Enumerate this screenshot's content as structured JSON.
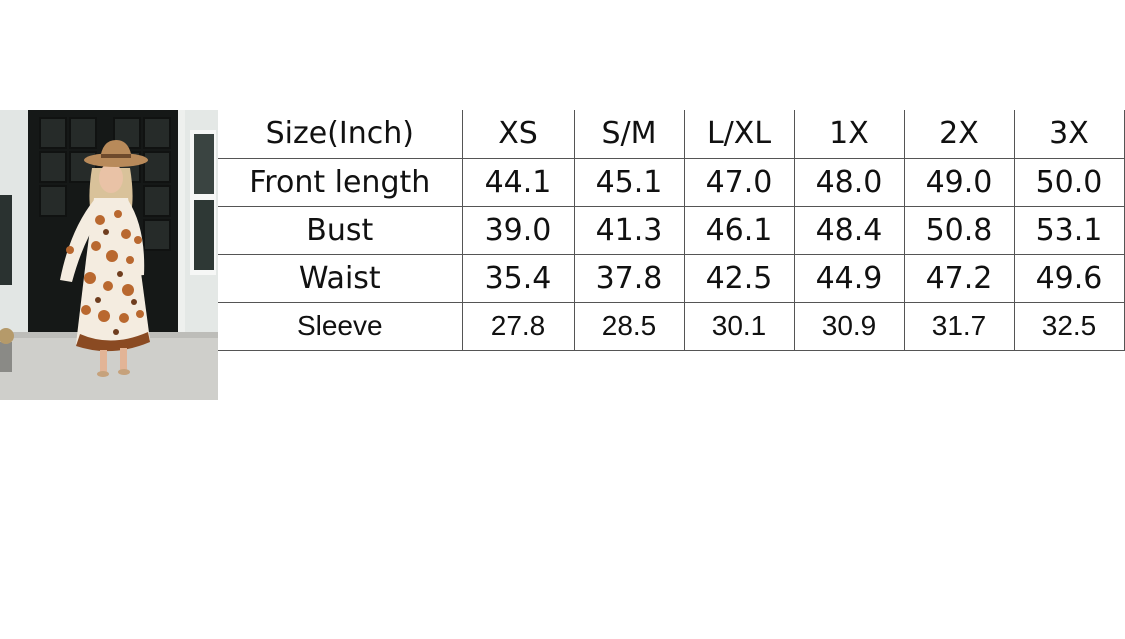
{
  "product_photo": {
    "icon": "woman-in-floral-maxi-dress-photo"
  },
  "size_chart": {
    "header": [
      "Size(Inch)",
      "XS",
      "S/M",
      "L/XL",
      "1X",
      "2X",
      "3X"
    ],
    "rows": [
      [
        "Front length",
        "44.1",
        "45.1",
        "47.0",
        "48.0",
        "49.0",
        "50.0"
      ],
      [
        "Bust",
        "39.0",
        "41.3",
        "46.1",
        "48.4",
        "50.8",
        "53.1"
      ],
      [
        "Waist",
        "35.4",
        "37.8",
        "42.5",
        "44.9",
        "47.2",
        "49.6"
      ],
      [
        "Sleeve",
        "27.8",
        "28.5",
        "30.1",
        "30.9",
        "31.7",
        "32.5"
      ]
    ]
  }
}
